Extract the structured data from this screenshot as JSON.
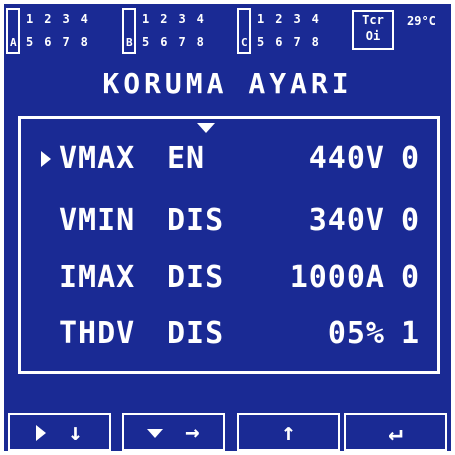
{
  "status_bar": {
    "groups": [
      {
        "letter": "A",
        "row1": "1234",
        "row2": "5678"
      },
      {
        "letter": "B",
        "row1": "1234",
        "row2": "5678"
      },
      {
        "letter": "C",
        "row1": "1234",
        "row2": "5678"
      }
    ],
    "tcr_line1": "Tcr",
    "tcr_line2": "Oi",
    "temperature": "29°C"
  },
  "title": "KORUMA AYARI",
  "protection_rows": [
    {
      "name": "VMAX",
      "state": "EN",
      "value": "440V",
      "flag": "0",
      "selected": true
    },
    {
      "name": "VMIN",
      "state": "DIS",
      "value": "340V",
      "flag": "0",
      "selected": false
    },
    {
      "name": "IMAX",
      "state": "DIS",
      "value": "1000A",
      "flag": "0",
      "selected": false
    },
    {
      "name": "THDV",
      "state": "DIS",
      "value": "05%",
      "flag": "1",
      "selected": false
    }
  ],
  "softkeys": {
    "key1_symbol": "↓",
    "key2_symbol": "→",
    "key3_symbol": "↑",
    "key4_symbol": "↵"
  },
  "icons": {
    "cursor": "right-triangle-icon",
    "column_marker": "down-triangle-icon"
  },
  "colors": {
    "screen_background": "#1a2a94",
    "foreground": "#ffffff"
  }
}
